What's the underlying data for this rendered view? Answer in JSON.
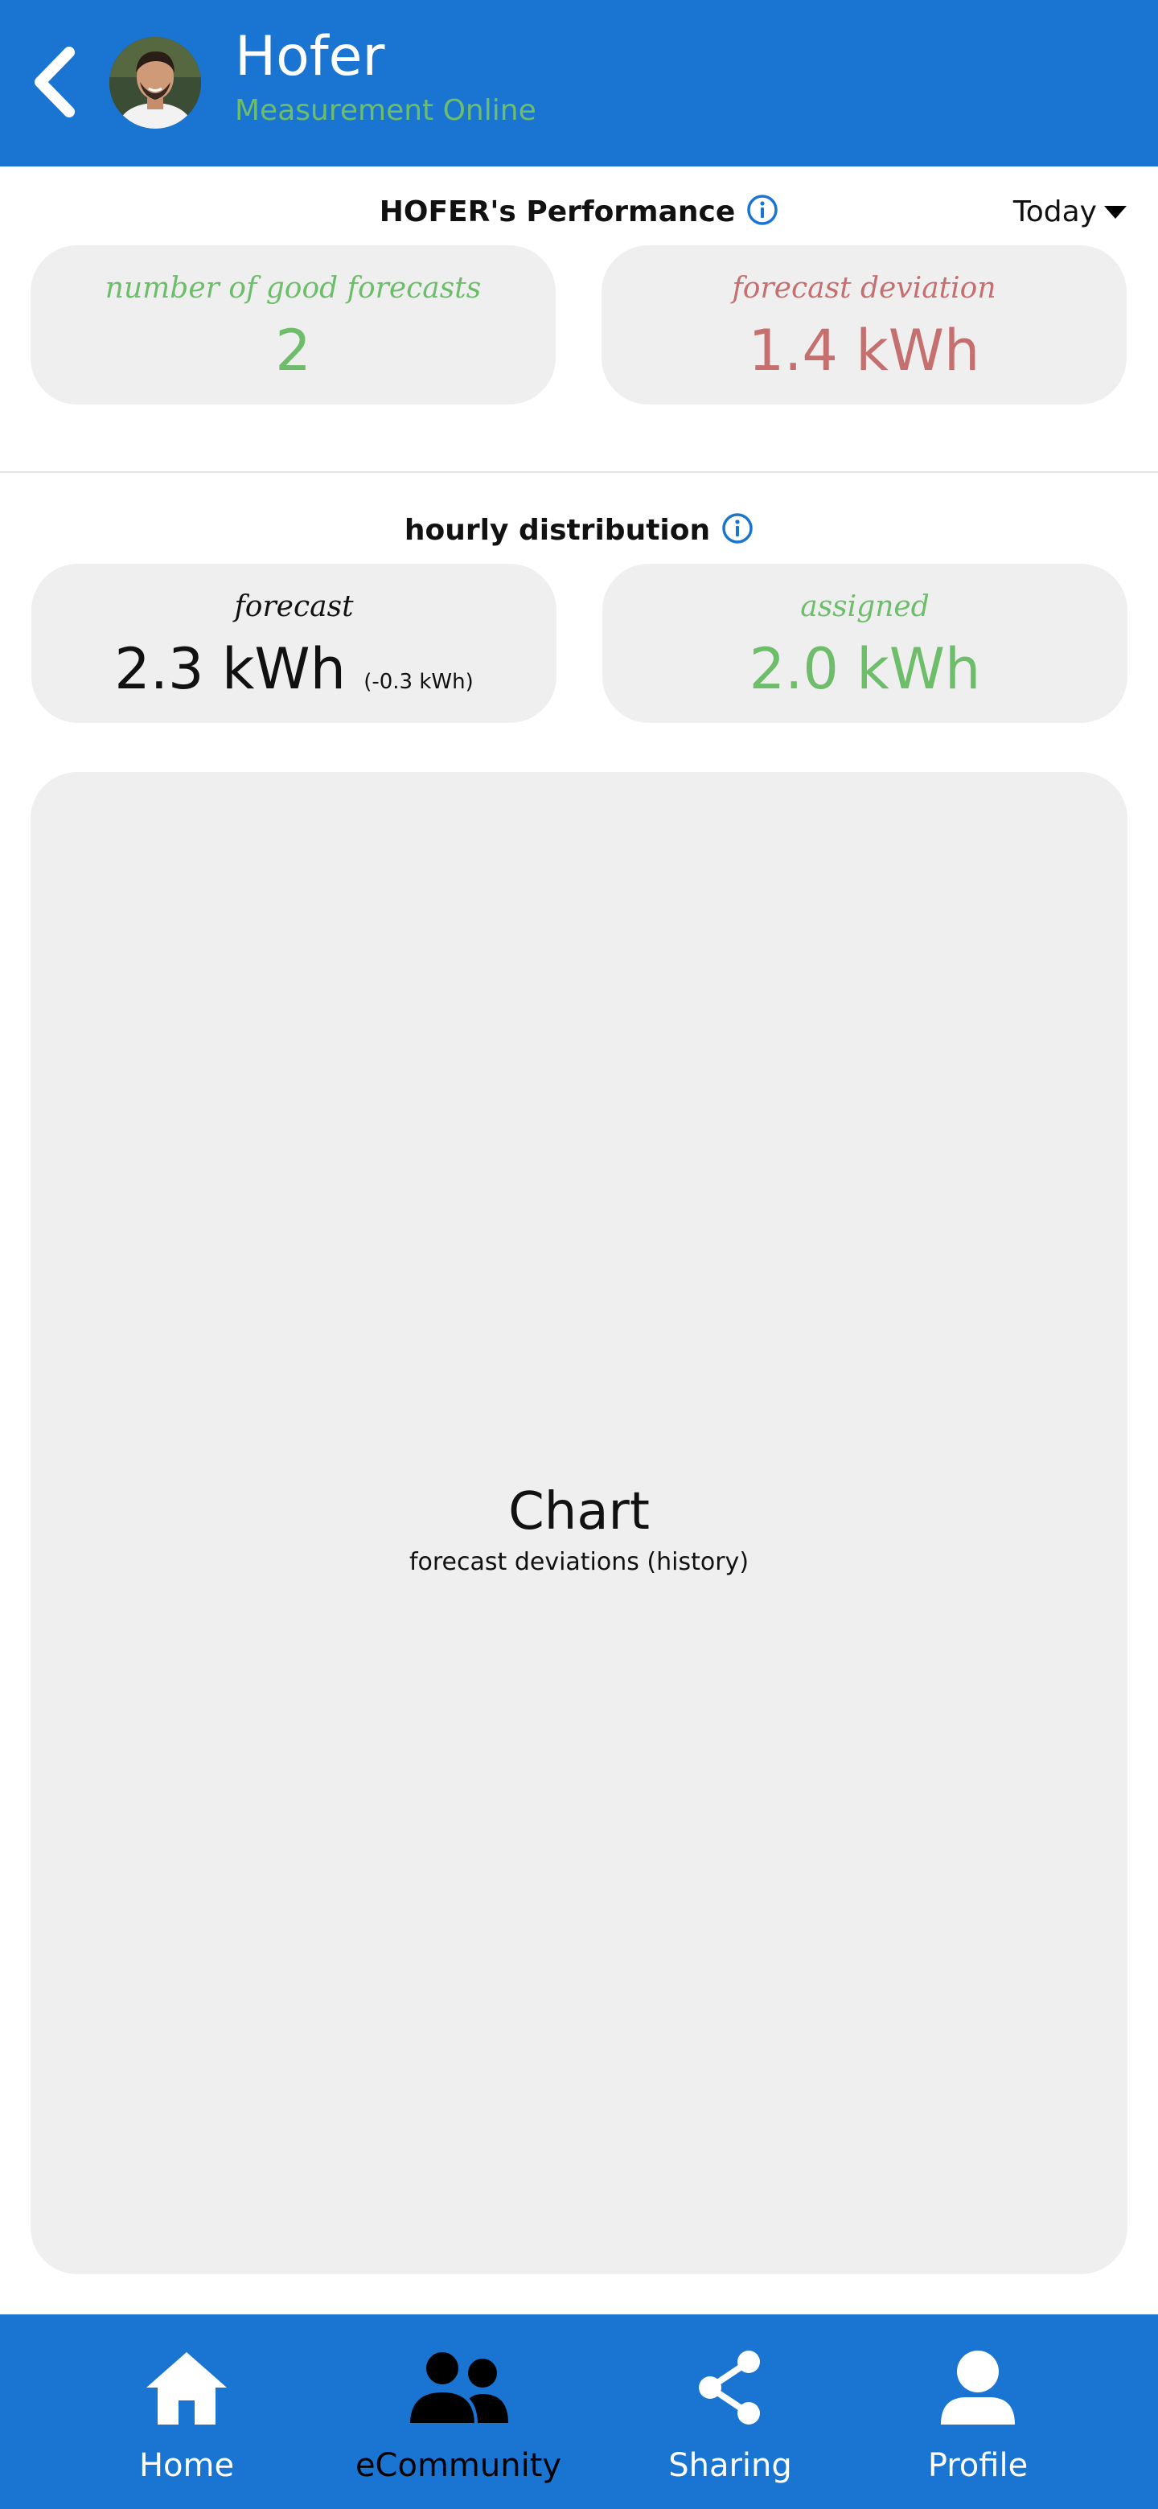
{
  "header": {
    "title": "Hofer",
    "subtitle": "Measurement Online"
  },
  "performance": {
    "title": "HOFER's Performance",
    "period": "Today",
    "good_forecasts": {
      "label": "number of good forecasts",
      "value": "2"
    },
    "forecast_deviation": {
      "label": "forecast deviation",
      "value": "1.4 kWh"
    }
  },
  "hourly": {
    "title": "hourly distribution",
    "forecast": {
      "label": "forecast",
      "value": "2.3 kWh",
      "delta": "(-0.3 kWh)"
    },
    "assigned": {
      "label": "assigned",
      "value": "2.0 kWh"
    }
  },
  "chart_placeholder": {
    "title": "Chart",
    "subtitle": "forecast deviations (history)"
  },
  "nav": {
    "items": [
      {
        "label": "Home",
        "icon": "home-icon"
      },
      {
        "label": "eCommunity",
        "icon": "community-icon"
      },
      {
        "label": "Sharing",
        "icon": "share-icon"
      },
      {
        "label": "Profile",
        "icon": "person-icon"
      }
    ],
    "active": "eCommunity"
  },
  "colors": {
    "primary": "#1a75d2",
    "green": "#6dbd6a",
    "red": "#c56f6f",
    "card": "#efefef"
  }
}
